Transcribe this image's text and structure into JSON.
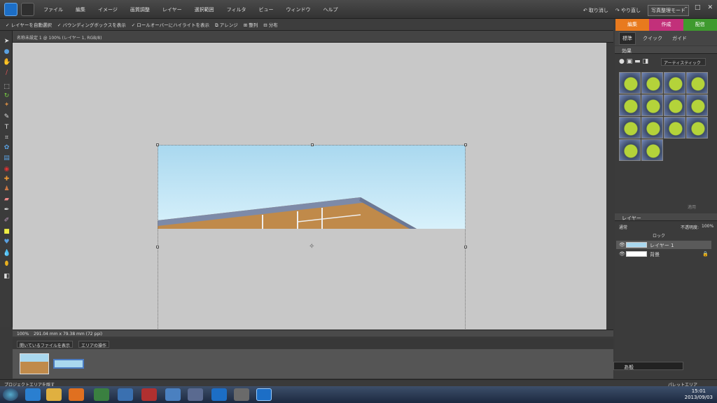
{
  "menubar": {
    "items": [
      "ファイル",
      "編集",
      "イメージ",
      "画質調整",
      "レイヤー",
      "選択範囲",
      "フィルタ",
      "ビュー",
      "ウィンドウ",
      "ヘルプ"
    ],
    "undo_label": "取り消し",
    "redo_label": "やり直し",
    "mode_label": "写真整理モード"
  },
  "options": {
    "auto_select": "レイヤーを自動選択",
    "bounding": "バウンディングボックスを表示",
    "rollover": "ロールオーバーにハイライトを表示",
    "arrange": "アレンジ",
    "align": "整列",
    "distribute": "分布"
  },
  "tabs": [
    {
      "label": "編集",
      "color": "#e87a1e"
    },
    {
      "label": "作成",
      "color": "#c2307a"
    },
    {
      "label": "配信",
      "color": "#3f9a2e"
    }
  ],
  "document": {
    "title": "名称未設定 1 @ 100% (レイヤー 1, RGB/8)",
    "zoom": "100%",
    "size_info": "291.04 mm x 79.38 mm (72 ppi)"
  },
  "project": {
    "show_files": "開いているファイルを表示",
    "area_ops": "エリアの操作",
    "hide_label": "プロジェクトエリアを隠す"
  },
  "panels": {
    "subtabs": [
      "標準",
      "クイック",
      "ガイド"
    ],
    "effects_title": "効果",
    "effects_filter": "アーティスティック",
    "apply_label": "適用",
    "layers_title": "レイヤー",
    "blend_mode": "通常",
    "opacity_label": "不透明度:",
    "opacity_value": "100%",
    "lock_label": "ロック",
    "layers": [
      {
        "name": "レイヤー 1"
      },
      {
        "name": "背景"
      }
    ],
    "palette_area": "パレットエリア"
  },
  "clock": {
    "time": "15:01",
    "date": "2013/09/03"
  },
  "floating_palette": {
    "text": "あ般"
  }
}
